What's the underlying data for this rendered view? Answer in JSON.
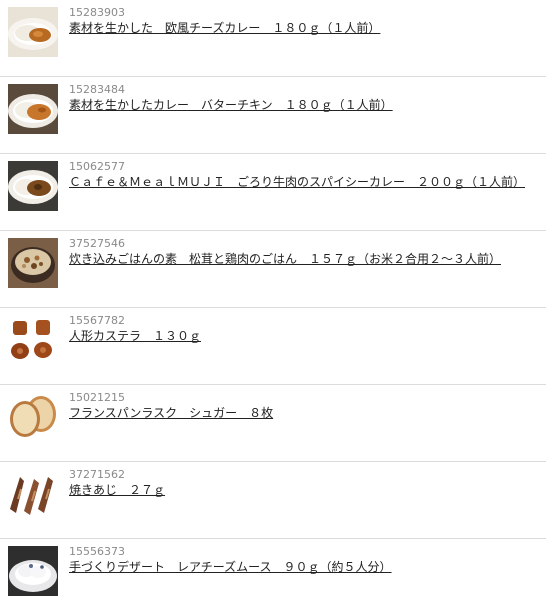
{
  "products": [
    {
      "code": "15283903",
      "title": "素材を生かした　欧風チーズカレー　１８０ｇ（１人前）",
      "image_icon": "cheese-curry-image"
    },
    {
      "code": "15283484",
      "title": "素材を生かしたカレー　バターチキン　１８０ｇ（１人前）",
      "image_icon": "butter-chicken-curry-image"
    },
    {
      "code": "15062577",
      "title": "Ｃａｆｅ＆ＭｅａｌＭＵＪＩ　ごろり牛肉のスパイシーカレー　２００ｇ（１人前）",
      "image_icon": "beef-curry-image"
    },
    {
      "code": "37527546",
      "title": "炊き込みごはんの素　松茸と鶏肉のごはん　１５７ｇ（お米２合用２〜３人前）",
      "image_icon": "mixed-rice-image"
    },
    {
      "code": "15567782",
      "title": "人形カステラ　１３０ｇ",
      "image_icon": "doll-castella-image"
    },
    {
      "code": "15021215",
      "title": "フランスパンラスク　シュガー　８枚",
      "image_icon": "rusk-image"
    },
    {
      "code": "37271562",
      "title": "焼きあじ　２７ｇ",
      "image_icon": "grilled-fish-image"
    },
    {
      "code": "15556373",
      "title": "手づくりデザート　レアチーズムース　９０ｇ（約５人分）",
      "image_icon": "cheese-mousse-image"
    }
  ]
}
